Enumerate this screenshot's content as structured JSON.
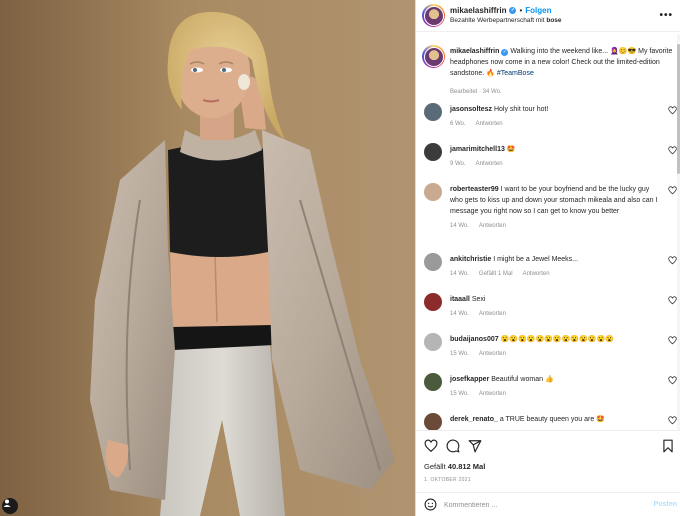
{
  "header": {
    "username": "mikaelashiffrin",
    "follow_label": "Folgen",
    "dot": "•",
    "sponsor_prefix": "Bezahlte Werbepartnerschaft mit",
    "sponsor_name": "bose",
    "more_label": "•••"
  },
  "caption": {
    "username": "mikaelashiffrin",
    "text": "Walking into the weekend like... 🧕😊😎 My favorite headphones now come in a new color! Check out the limited-edition sandstone. 🔥",
    "hashtag": "#TeamBose",
    "meta": "Bearbeitet · 34 Wo."
  },
  "comments": [
    {
      "user": "jasonsoltesz",
      "text": "Holy shit tour hot!",
      "time": "6 Wo.",
      "likes": "",
      "reply": "Antworten",
      "avatar_color": "#5a6b78"
    },
    {
      "user": "jamarimitchell13",
      "text": "🤩",
      "time": "9 Wo.",
      "likes": "",
      "reply": "Antworten",
      "avatar_color": "#3b3b3b"
    },
    {
      "user": "roberteaster99",
      "text": "I want to be your boyfriend and be the lucky guy who gets to kiss up and down your stomach mikeala and also can I message you right now so I can get to know you better",
      "time": "14 Wo.",
      "likes": "",
      "reply": "Antworten",
      "avatar_color": "#c9a98f"
    },
    {
      "user": "ankitchristie",
      "text": "I might be a Jewel Meeks...",
      "time": "14 Wo.",
      "likes": "Gefällt 1 Mal",
      "reply": "Antworten",
      "avatar_color": "#9a9a9a"
    },
    {
      "user": "itaaall",
      "text": "Sexi",
      "time": "14 Wo.",
      "likes": "",
      "reply": "Antworten",
      "avatar_color": "#8b2b2b"
    },
    {
      "user": "budaijanos007",
      "text": "😮😮😮😮😮😮😮😮😮😮😮😮😮",
      "time": "15 Wo.",
      "likes": "",
      "reply": "Antworten",
      "avatar_color": "#b5b5b5"
    },
    {
      "user": "josefkapper",
      "text": "Beautiful woman 👍",
      "time": "15 Wo.",
      "likes": "",
      "reply": "Antworten",
      "avatar_color": "#4a5a3c"
    },
    {
      "user": "derek_renato_",
      "text": "a TRUE beauty queen you are 🤩",
      "time": "",
      "likes": "",
      "reply": "",
      "avatar_color": "#6b4a3a"
    }
  ],
  "footer": {
    "likes_prefix": "Gefällt",
    "likes_count": "40.812 Mal",
    "date": "1. OKTOBER 2021",
    "comment_placeholder": "Kommentieren ...",
    "post_label": "Posten"
  },
  "icons": {
    "like": "heart-icon",
    "comment": "comment-icon",
    "share": "share-icon",
    "save": "bookmark-icon",
    "emoji": "emoji-icon",
    "tag": "user-tag-icon"
  },
  "colors": {
    "accent": "#0095f6",
    "verified": "#3897f0",
    "muted": "#8e8e8e",
    "hashtag": "#00376b"
  }
}
